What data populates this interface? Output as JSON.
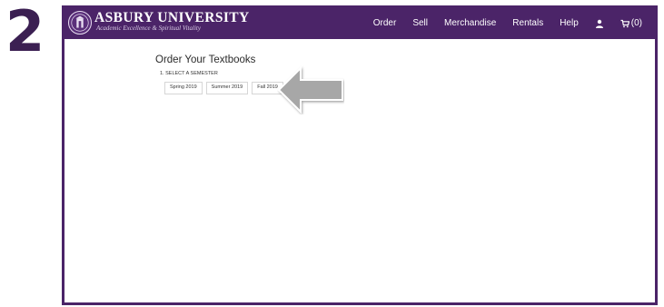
{
  "step_number": "2",
  "brand": {
    "name": "ASBURY UNIVERSITY",
    "tagline": "Academic Excellence & Spiritual Vitality"
  },
  "nav": {
    "order": "Order",
    "sell": "Sell",
    "merchandise": "Merchandise",
    "rentals": "Rentals",
    "help": "Help",
    "account_icon": "user-icon",
    "cart_icon": "cart-icon",
    "cart_count": "(0)"
  },
  "main": {
    "title": "Order Your Textbooks",
    "step_label": "1. SELECT A SEMESTER",
    "semesters": [
      "Spring 2019",
      "Summer 2019",
      "Fall 2019"
    ]
  },
  "colors": {
    "brand_purple": "#4b2468",
    "step_number": "#3b1f52",
    "arrow": "#a7a7a7"
  }
}
